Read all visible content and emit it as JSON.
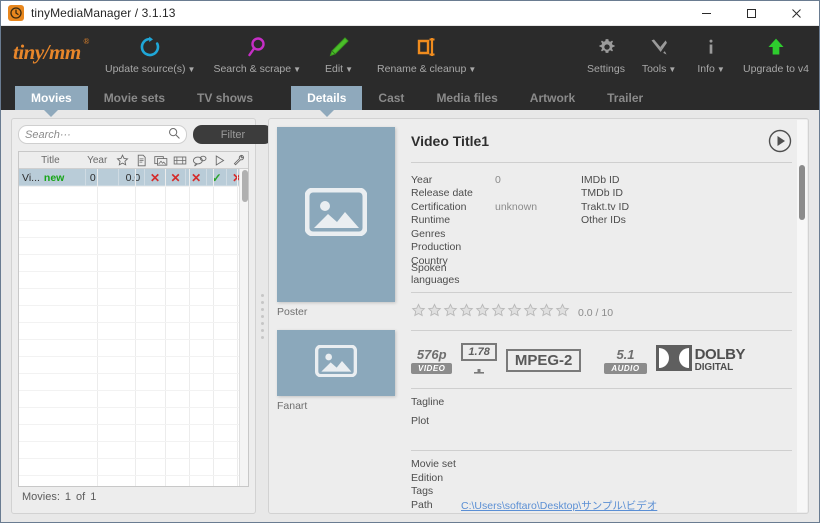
{
  "window": {
    "title": "tinyMediaManager / 3.1.13",
    "app_icon": "clock-icon",
    "minimize": "─",
    "maximize": "□",
    "close": "✕"
  },
  "toolbar": {
    "logo": "tiny/mm",
    "logo_reg": "®",
    "left_items": [
      {
        "label": "Update source(s)",
        "icon": "refresh-icon",
        "caret": "▼",
        "color": "#1fa7d8"
      },
      {
        "label": "Search & scrape",
        "icon": "magnifier-icon",
        "caret": "▼",
        "color": "#c62ec6"
      },
      {
        "label": "Edit",
        "icon": "pencil-icon",
        "caret": "▼",
        "color": "#4bbf2a"
      },
      {
        "label": "Rename & cleanup",
        "icon": "rename-icon",
        "caret": "▼",
        "color": "#f08c1e"
      }
    ],
    "right_items": [
      {
        "label": "Settings",
        "icon": "gear-icon",
        "caret": "",
        "color": "#9a9a9a"
      },
      {
        "label": "Tools",
        "icon": "tools-icon",
        "caret": "▼",
        "color": "#9a9a9a"
      },
      {
        "label": "Info",
        "icon": "info-icon",
        "caret": "▼",
        "color": "#9a9a9a"
      },
      {
        "label": "Upgrade to v4",
        "icon": "up-arrow-icon",
        "caret": "",
        "color": "#2ecc2e"
      }
    ]
  },
  "main_tabs": [
    {
      "label": "Movies",
      "active": true
    },
    {
      "label": "Movie sets",
      "active": false
    },
    {
      "label": "TV shows",
      "active": false
    }
  ],
  "detail_tabs": [
    {
      "label": "Details",
      "active": true
    },
    {
      "label": "Cast",
      "active": false
    },
    {
      "label": "Media files",
      "active": false
    },
    {
      "label": "Artwork",
      "active": false
    },
    {
      "label": "Trailer",
      "active": false
    }
  ],
  "left": {
    "search": {
      "placeholder": "Search···",
      "value": "",
      "icon": "search-icon"
    },
    "filter_button": "Filter",
    "table": {
      "columns": [
        {
          "key": "title",
          "label": "Title",
          "type": "text"
        },
        {
          "key": "year",
          "label": "Year",
          "type": "text"
        },
        {
          "key": "rating",
          "label": "",
          "icon": "star-icon",
          "type": "icon"
        },
        {
          "key": "nfo",
          "label": "",
          "icon": "document-icon",
          "type": "icon"
        },
        {
          "key": "images",
          "label": "",
          "icon": "images-icon",
          "type": "icon"
        },
        {
          "key": "video",
          "label": "",
          "icon": "filmstrip-icon",
          "type": "icon"
        },
        {
          "key": "subtitles",
          "label": "",
          "icon": "subtitle-icon",
          "type": "icon"
        },
        {
          "key": "watched",
          "label": "",
          "icon": "play-icon",
          "type": "icon"
        },
        {
          "key": "tools",
          "label": "",
          "icon": "wrench-icon",
          "type": "icon"
        }
      ],
      "rows": [
        {
          "title": "Vi...",
          "badge": "new",
          "year": "0",
          "rating": "0.0",
          "marks": [
            "x",
            "x",
            "x",
            "v",
            "x"
          ]
        }
      ]
    },
    "status": {
      "label": "Movies:",
      "count": "1",
      "of": "of",
      "total": "1"
    }
  },
  "detail": {
    "title": "Video Title1",
    "play_icon": "play-circle-icon",
    "artwork": [
      {
        "caption": "Poster",
        "icon": "image-placeholder-icon"
      },
      {
        "caption": "Fanart",
        "icon": "image-placeholder-icon"
      }
    ],
    "meta_left": [
      {
        "label": "Year",
        "value": "0"
      },
      {
        "label": "Release date",
        "value": ""
      },
      {
        "label": "Certification",
        "value": "unknown"
      },
      {
        "label": "Runtime",
        "value": ""
      },
      {
        "label": "Genres",
        "value": ""
      },
      {
        "label": "Production",
        "value": ""
      },
      {
        "label": "Country",
        "value": ""
      },
      {
        "label": "Spoken languages",
        "value": ""
      }
    ],
    "meta_right": [
      {
        "label": "IMDb ID",
        "value": ""
      },
      {
        "label": "TMDb ID",
        "value": ""
      },
      {
        "label": "Trakt.tv ID",
        "value": ""
      },
      {
        "label": "Other IDs",
        "value": ""
      }
    ],
    "rating": {
      "stars_total": 10,
      "stars_filled": 0,
      "text": "0.0 / 10"
    },
    "badges": {
      "video_resolution": {
        "top": "576p",
        "sub": "VIDEO"
      },
      "aspect_ratio": "1.78",
      "video_codec": "MPEG-2",
      "audio_channels": {
        "top": "5.1",
        "sub": "AUDIO"
      },
      "audio_codec": {
        "line1": "DOLBY",
        "line2": "DIGITAL",
        "reg": "."
      }
    },
    "text_fields": [
      {
        "label": "Tagline",
        "value": ""
      },
      {
        "label": "Plot",
        "value": ""
      }
    ],
    "bottom_fields": [
      {
        "label": "Movie set",
        "value": "",
        "link": false
      },
      {
        "label": "Edition",
        "value": "",
        "link": false
      },
      {
        "label": "Tags",
        "value": "",
        "link": false
      },
      {
        "label": "Path",
        "value": "C:\\Users\\softaro\\Desktop\\サンプル\\ビデオ",
        "link": true
      }
    ]
  },
  "colors": {
    "toolbar_bg": "#2b2b2b",
    "accent_tab": "#8fa9bc",
    "logo_orange": "#e8862a",
    "row_selected": "#b9ccd8",
    "link_blue": "#5b8fd4",
    "artwork_bg": "#8ba8bb",
    "mark_red": "#d42b2b",
    "mark_green": "#29a329",
    "new_green": "#17a517"
  }
}
